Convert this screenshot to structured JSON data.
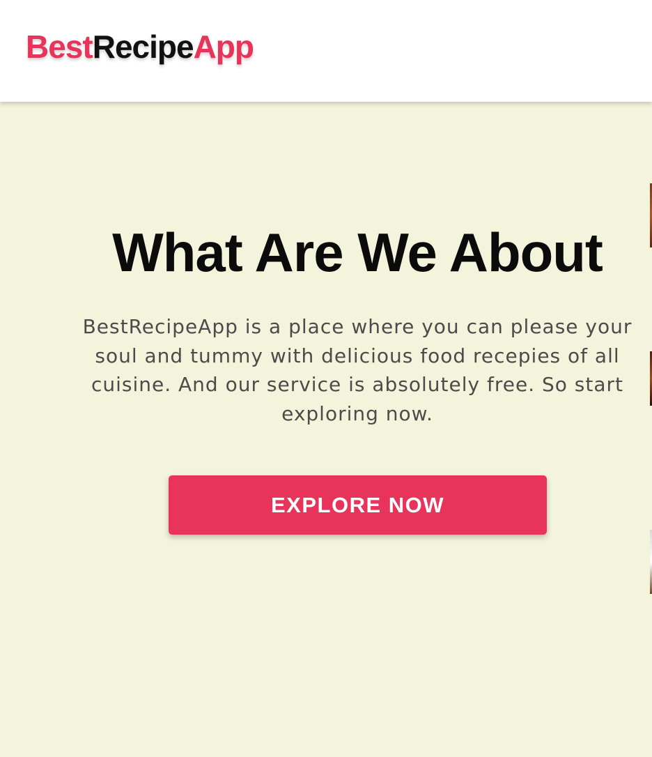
{
  "header": {
    "logo": {
      "part1": "Best",
      "part2": "Recipe",
      "part3": "App"
    }
  },
  "main": {
    "title": "What Are We About",
    "description": "BestRecipeApp is a place where you can please your soul and tummy with delicious food recepies of all cuisine. And our service is absolutely free. So start exploring now.",
    "cta_label": "EXPLORE NOW"
  },
  "colors": {
    "accent": "#e8345a",
    "background": "#f4f3dc",
    "header_background": "#ffffff",
    "text_dark": "#0b0b0b",
    "text_muted": "#4b4b4b"
  }
}
